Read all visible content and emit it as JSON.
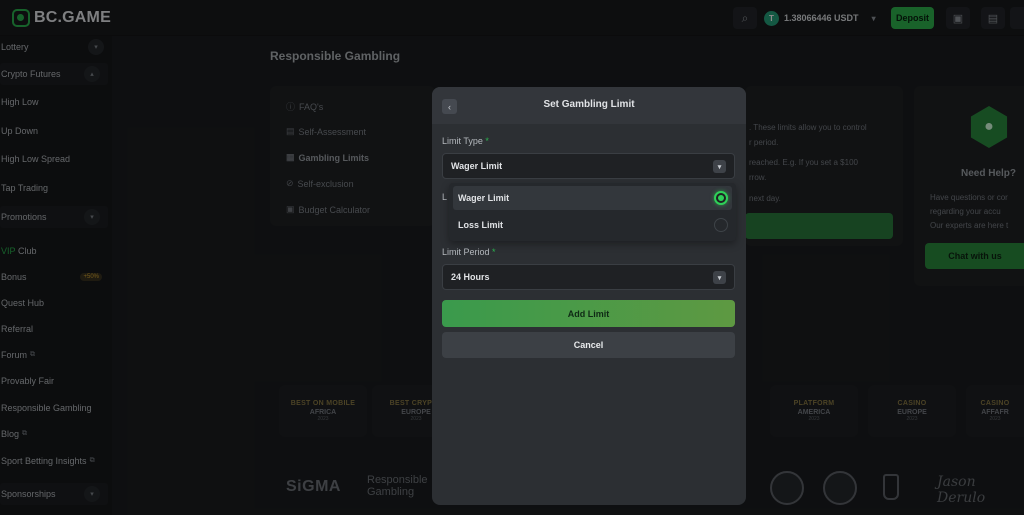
{
  "brand": {
    "name": "BC.GAME"
  },
  "topbar": {
    "balance": "1.38066446 USDT",
    "currency_icon": "T",
    "deposit_label": "Deposit"
  },
  "sidebar": {
    "items": [
      {
        "label": "Lottery",
        "expandable": true
      },
      {
        "label": "Crypto Futures",
        "expandable": true
      },
      {
        "label": "High Low"
      },
      {
        "label": "Up Down"
      },
      {
        "label": "High Low Spread"
      },
      {
        "label": "Tap Trading"
      },
      {
        "label": "Promotions",
        "expandable": true
      },
      {
        "label_prefix": "VIP",
        "label": "Club"
      },
      {
        "label": "Bonus",
        "badge": "+50%"
      },
      {
        "label": "Quest Hub"
      },
      {
        "label": "Referral"
      },
      {
        "label": "Forum"
      },
      {
        "label": "Provably Fair"
      },
      {
        "label": "Responsible Gambling"
      },
      {
        "label": "Blog"
      },
      {
        "label": "Sport Betting Insights"
      },
      {
        "label": "Sponsorships",
        "expandable": true
      }
    ]
  },
  "page": {
    "title": "Responsible Gambling",
    "menu": [
      {
        "label": "FAQ's"
      },
      {
        "label": "Self-Assessment"
      },
      {
        "label": "Gambling Limits",
        "active": true
      },
      {
        "label": "Self-exclusion"
      },
      {
        "label": "Budget Calculator"
      }
    ],
    "info_lines": [
      ". These limits allow you to control",
      "r period.",
      "reached. E.g. If you set a $100",
      "rrow.",
      "next day."
    ],
    "help": {
      "title": "Need Help?",
      "lines": [
        "Have questions or cor",
        "regarding your accu",
        "Our experts are here t"
      ],
      "chat_label": "Chat with us"
    },
    "awards": [
      {
        "title": "BEST ON MOBILE",
        "region": "AFRICA",
        "year": "2023"
      },
      {
        "title": "BEST CRYPTO",
        "region": "EUROPE",
        "year": "2023"
      },
      {
        "title": "PLATFORM",
        "region": "AMERICA",
        "year": "2023"
      },
      {
        "title": "CASINO",
        "region": "EUROPE",
        "year": "2023"
      },
      {
        "title": "CASINO",
        "region": "AFFAFR",
        "year": "2023"
      }
    ],
    "footer": {
      "sigma": "SiGMA",
      "rg_line1": "Responsible",
      "rg_line2": "Gambling",
      "signature": "Jason Derulo"
    }
  },
  "modal": {
    "title": "Set Gambling Limit",
    "limit_type": {
      "label": "Limit Type",
      "value": "Wager Limit"
    },
    "options": [
      {
        "label": "Wager Limit",
        "selected": true
      },
      {
        "label": "Loss Limit",
        "selected": false
      }
    ],
    "hidden_label": "L",
    "limit_period": {
      "label": "Limit Period",
      "value": "24 Hours"
    },
    "add_label": "Add Limit",
    "cancel_label": "Cancel",
    "required_mark": "*"
  },
  "colors": {
    "accent": "#2bb34f",
    "background": "#1b1d1f",
    "modal": "#2c2f33"
  }
}
